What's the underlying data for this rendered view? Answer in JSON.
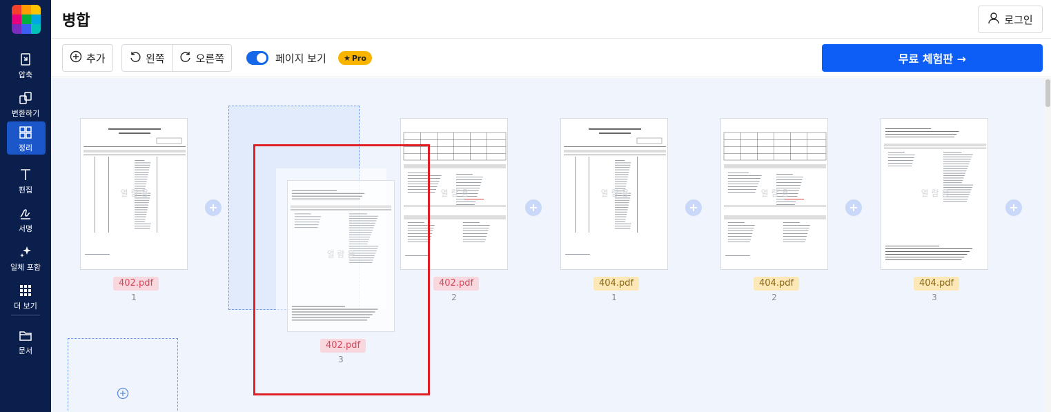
{
  "app": {
    "title": "병합",
    "login_label": "로그인"
  },
  "sidebar": {
    "items": [
      {
        "label": "압축",
        "icon": "compress-icon"
      },
      {
        "label": "변환하기",
        "icon": "convert-icon"
      },
      {
        "label": "정리",
        "icon": "organize-icon",
        "active": true
      },
      {
        "label": "편집",
        "icon": "text-edit-icon"
      },
      {
        "label": "서명",
        "icon": "signature-icon"
      },
      {
        "label": "일체 포함",
        "icon": "sparkle-icon"
      },
      {
        "label": "더 보기",
        "icon": "grid-dots-icon"
      },
      {
        "label": "문서",
        "icon": "folder-icon"
      }
    ]
  },
  "toolbar": {
    "add_label": "추가",
    "rotate_left_label": "왼쪽",
    "rotate_right_label": "오른쪽",
    "page_view_label": "페이지 보기",
    "pro_badge": "Pro",
    "trial_label": "무료 체험판 →"
  },
  "pages": [
    {
      "file": "402.pdf",
      "num": "1",
      "color": "red"
    },
    {
      "file": "402.pdf",
      "num": "2",
      "color": "red"
    },
    {
      "file": "404.pdf",
      "num": "1",
      "color": "yellow"
    },
    {
      "file": "404.pdf",
      "num": "2",
      "color": "yellow"
    },
    {
      "file": "404.pdf",
      "num": "3",
      "color": "yellow"
    }
  ],
  "dragging": {
    "file": "402.pdf",
    "num": "3",
    "color": "red"
  },
  "doc_watermark": "열 람 용",
  "colors": {
    "sidebar_bg": "#0b1f4d",
    "accent": "#0d5ef7",
    "highlight": "#e01e26"
  }
}
